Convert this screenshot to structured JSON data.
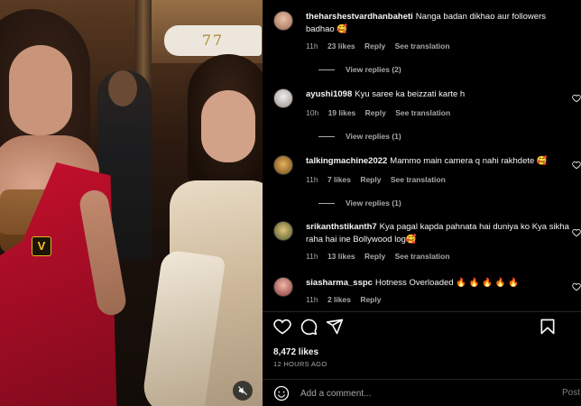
{
  "media": {
    "sign_text": "77",
    "badge_text": "V",
    "mute_icon": "speaker-muted-icon"
  },
  "comments": [
    {
      "username": "theharshestvardhanbaheti",
      "text": "Nanga badan dikhao aur followers badhao 🥰",
      "time": "11h",
      "likes": "23 likes",
      "reply": "Reply",
      "translate": "See translation",
      "view_replies": "View replies (2)",
      "avatar_color": "#d9a08a"
    },
    {
      "username": "ayushi1098",
      "text": "Kyu saree ka beizzati karte h",
      "time": "10h",
      "likes": "19 likes",
      "reply": "Reply",
      "translate": "See translation",
      "view_replies": "View replies (1)",
      "avatar_color": "#c9c2bd"
    },
    {
      "username": "talkingmachine2022",
      "text": "Mammo main camera q nahi rakhdete 🥰",
      "time": "11h",
      "likes": "7 likes",
      "reply": "Reply",
      "translate": "See translation",
      "view_replies": "View replies (1)",
      "avatar_color": "#b5833c"
    },
    {
      "username": "srikanthstikanth7",
      "text": "Kya pagal kapda pahnata hai duniya ko Kya sikha raha hai ine Bollywood log🥰",
      "time": "11h",
      "likes": "13 likes",
      "reply": "Reply",
      "translate": "See translation",
      "avatar_color": "#7a8a4a"
    },
    {
      "username": "siasharma_sspc",
      "text": "Hotness Overloaded 🔥 🔥 🔥 🔥 🔥",
      "time": "11h",
      "likes": "2 likes",
      "reply": "Reply",
      "avatar_color": "#c26a6a"
    }
  ],
  "actions": {
    "like_icon": "heart-icon",
    "comment_icon": "comment-icon",
    "share_icon": "send-icon",
    "save_icon": "bookmark-icon"
  },
  "likes_count": "8,472 likes",
  "time_ago": "12 HOURS AGO",
  "add_comment": {
    "placeholder": "Add a comment...",
    "post_label": "Post",
    "emoji_icon": "emoji-icon"
  }
}
